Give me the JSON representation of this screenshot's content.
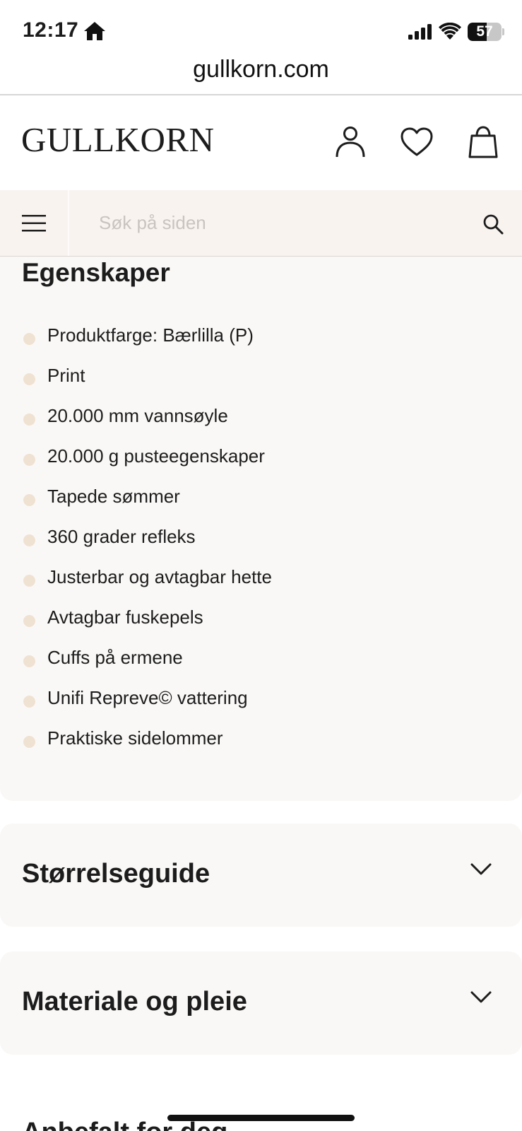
{
  "status_bar": {
    "time": "12:17",
    "battery_level": "57",
    "battery_fraction": 0.57
  },
  "browser": {
    "url": "gullkorn.com"
  },
  "header": {
    "logo": "GULLKORN",
    "icons": [
      "user-icon",
      "heart-icon",
      "shopping-bag-icon"
    ]
  },
  "search": {
    "placeholder": "Søk på siden"
  },
  "features": {
    "title": "Egenskaper",
    "items": [
      "Produktfarge: Bærlilla (P)",
      "Print",
      "20.000 mm vannsøyle",
      "20.000 g pusteegenskaper",
      "Tapede sømmer",
      "360 grader refleks",
      "Justerbar og avtagbar hette",
      "Avtagbar fuskepels",
      "Cuffs på ermene",
      "Unifi Repreve© vattering",
      "Praktiske sidelommer"
    ]
  },
  "accordions": [
    {
      "title": "Størrelseguide",
      "expanded": false
    },
    {
      "title": "Materiale og pleie",
      "expanded": false
    }
  ],
  "recommended": {
    "title": "Anbefalt for deg"
  },
  "colors": {
    "card_background": "#faf8f6",
    "search_background": "#f8f3ef",
    "bullet": "#f0e2d2",
    "text": "#1c1c1c"
  }
}
